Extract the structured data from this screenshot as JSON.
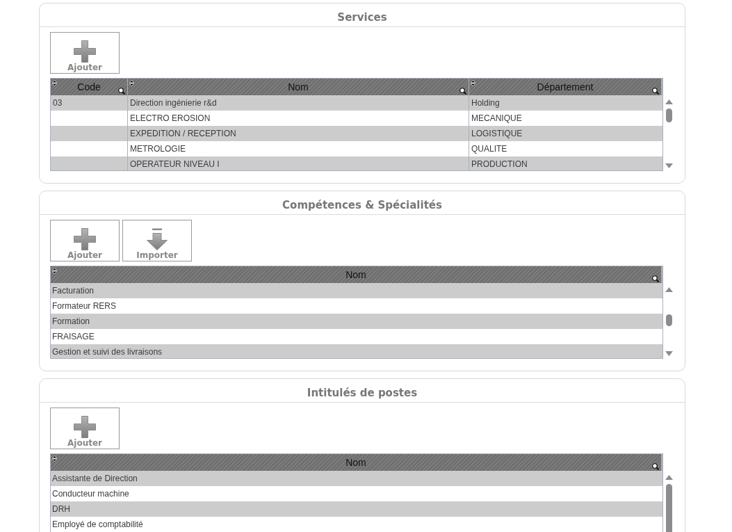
{
  "sections": [
    {
      "title": "Services",
      "buttons": [
        {
          "label": "Ajouter",
          "kind": "add"
        }
      ],
      "table": {
        "columns": [
          "Code",
          "Nom",
          "Département"
        ],
        "rows": [
          [
            "03",
            "Direction ingénierie r&d",
            "Holding"
          ],
          [
            null,
            "ELECTRO EROSION",
            "MECANIQUE"
          ],
          [
            null,
            "EXPEDITION / RECEPTION",
            "LOGISTIQUE"
          ],
          [
            null,
            "METROLOGIE",
            "QUALITE"
          ],
          [
            null,
            "OPERATEUR NIVEAU I",
            "PRODUCTION"
          ]
        ]
      }
    },
    {
      "title": "Compétences & Spécialités",
      "buttons": [
        {
          "label": "Ajouter",
          "kind": "add"
        },
        {
          "label": "Importer",
          "kind": "import"
        }
      ],
      "table": {
        "columns": [
          "Nom"
        ],
        "rows": [
          [
            "Facturation"
          ],
          [
            "Formateur RERS"
          ],
          [
            "Formation"
          ],
          [
            "FRAISAGE"
          ],
          [
            "Gestion et suivi des livraisons"
          ]
        ]
      }
    },
    {
      "title": "Intitulés de postes",
      "buttons": [
        {
          "label": "Ajouter",
          "kind": "add"
        }
      ],
      "table": {
        "columns": [
          "Nom"
        ],
        "rows": [
          [
            "Assistante de Direction"
          ],
          [
            "Conducteur machine"
          ],
          [
            "DRH"
          ],
          [
            "Employé de comptabilité"
          ]
        ]
      }
    }
  ]
}
